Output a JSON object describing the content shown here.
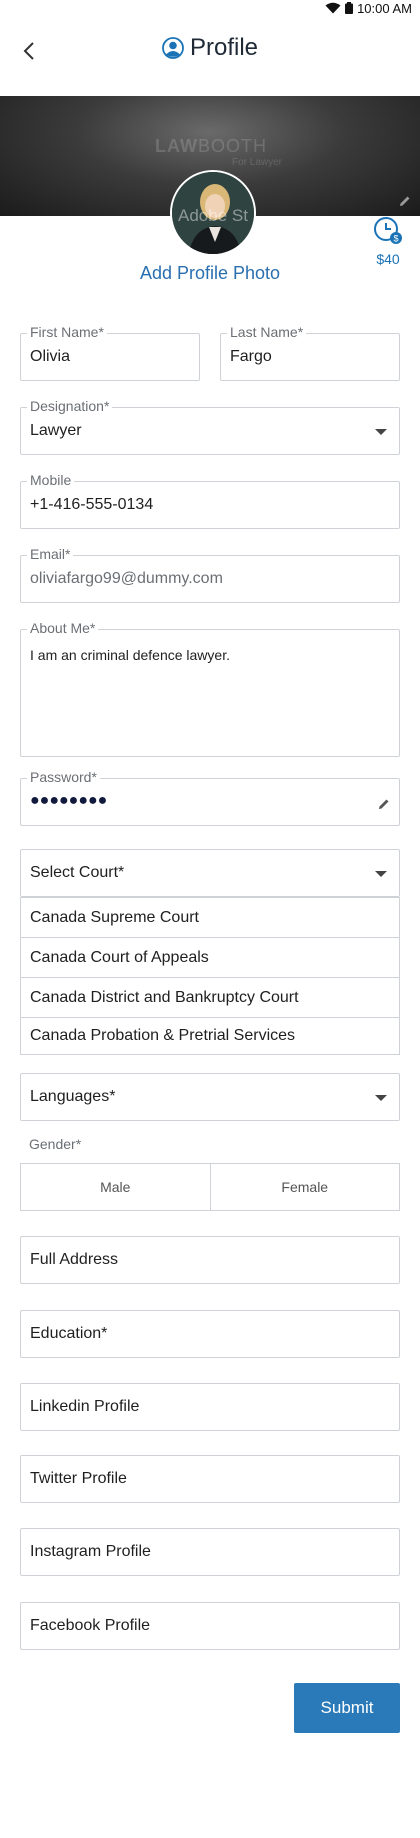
{
  "status_bar": {
    "time": "10:00 AM"
  },
  "header": {
    "title": "Profile"
  },
  "banner": {
    "logo_text_bold": "LAW",
    "logo_text_light": "BOOTH",
    "logo_sub": "For Lawyer"
  },
  "profile": {
    "avatar_overlay": "Adobe St",
    "add_photo_label": "Add Profile Photo",
    "wallet_amount": "$40"
  },
  "form": {
    "first_name": {
      "label": "First Name*",
      "value": "Olivia"
    },
    "last_name": {
      "label": "Last Name*",
      "value": "Fargo"
    },
    "designation": {
      "label": "Designation*",
      "value": "Lawyer"
    },
    "mobile": {
      "label": "Mobile",
      "value": "+1-416-555-0134"
    },
    "email": {
      "label": "Email*",
      "value": "oliviafargo99@dummy.com"
    },
    "about": {
      "label": "About Me*",
      "value": "I am an criminal defence lawyer."
    },
    "password": {
      "label": "Password*",
      "value": "●●●●●●●●"
    },
    "court": {
      "placeholder": "Select Court*",
      "options": [
        "Canada Supreme Court",
        "Canada Court of Appeals",
        "Canada District and Bankruptcy Court",
        "Canada Probation & Pretrial Services"
      ]
    },
    "languages": {
      "placeholder": "Languages*"
    },
    "gender": {
      "label": "Gender*",
      "options": [
        "Male",
        "Female"
      ]
    },
    "full_address": {
      "placeholder": "Full Address"
    },
    "education": {
      "placeholder": "Education*"
    },
    "linkedin": {
      "placeholder": "Linkedin Profile"
    },
    "twitter": {
      "placeholder": "Twitter Profile"
    },
    "instagram": {
      "placeholder": "Instagram Profile"
    },
    "facebook": {
      "placeholder": "Facebook Profile"
    },
    "submit_label": "Submit"
  },
  "colors": {
    "accent": "#2a7ab9",
    "link": "#2a6fb0",
    "border": "#cfd3d8"
  }
}
